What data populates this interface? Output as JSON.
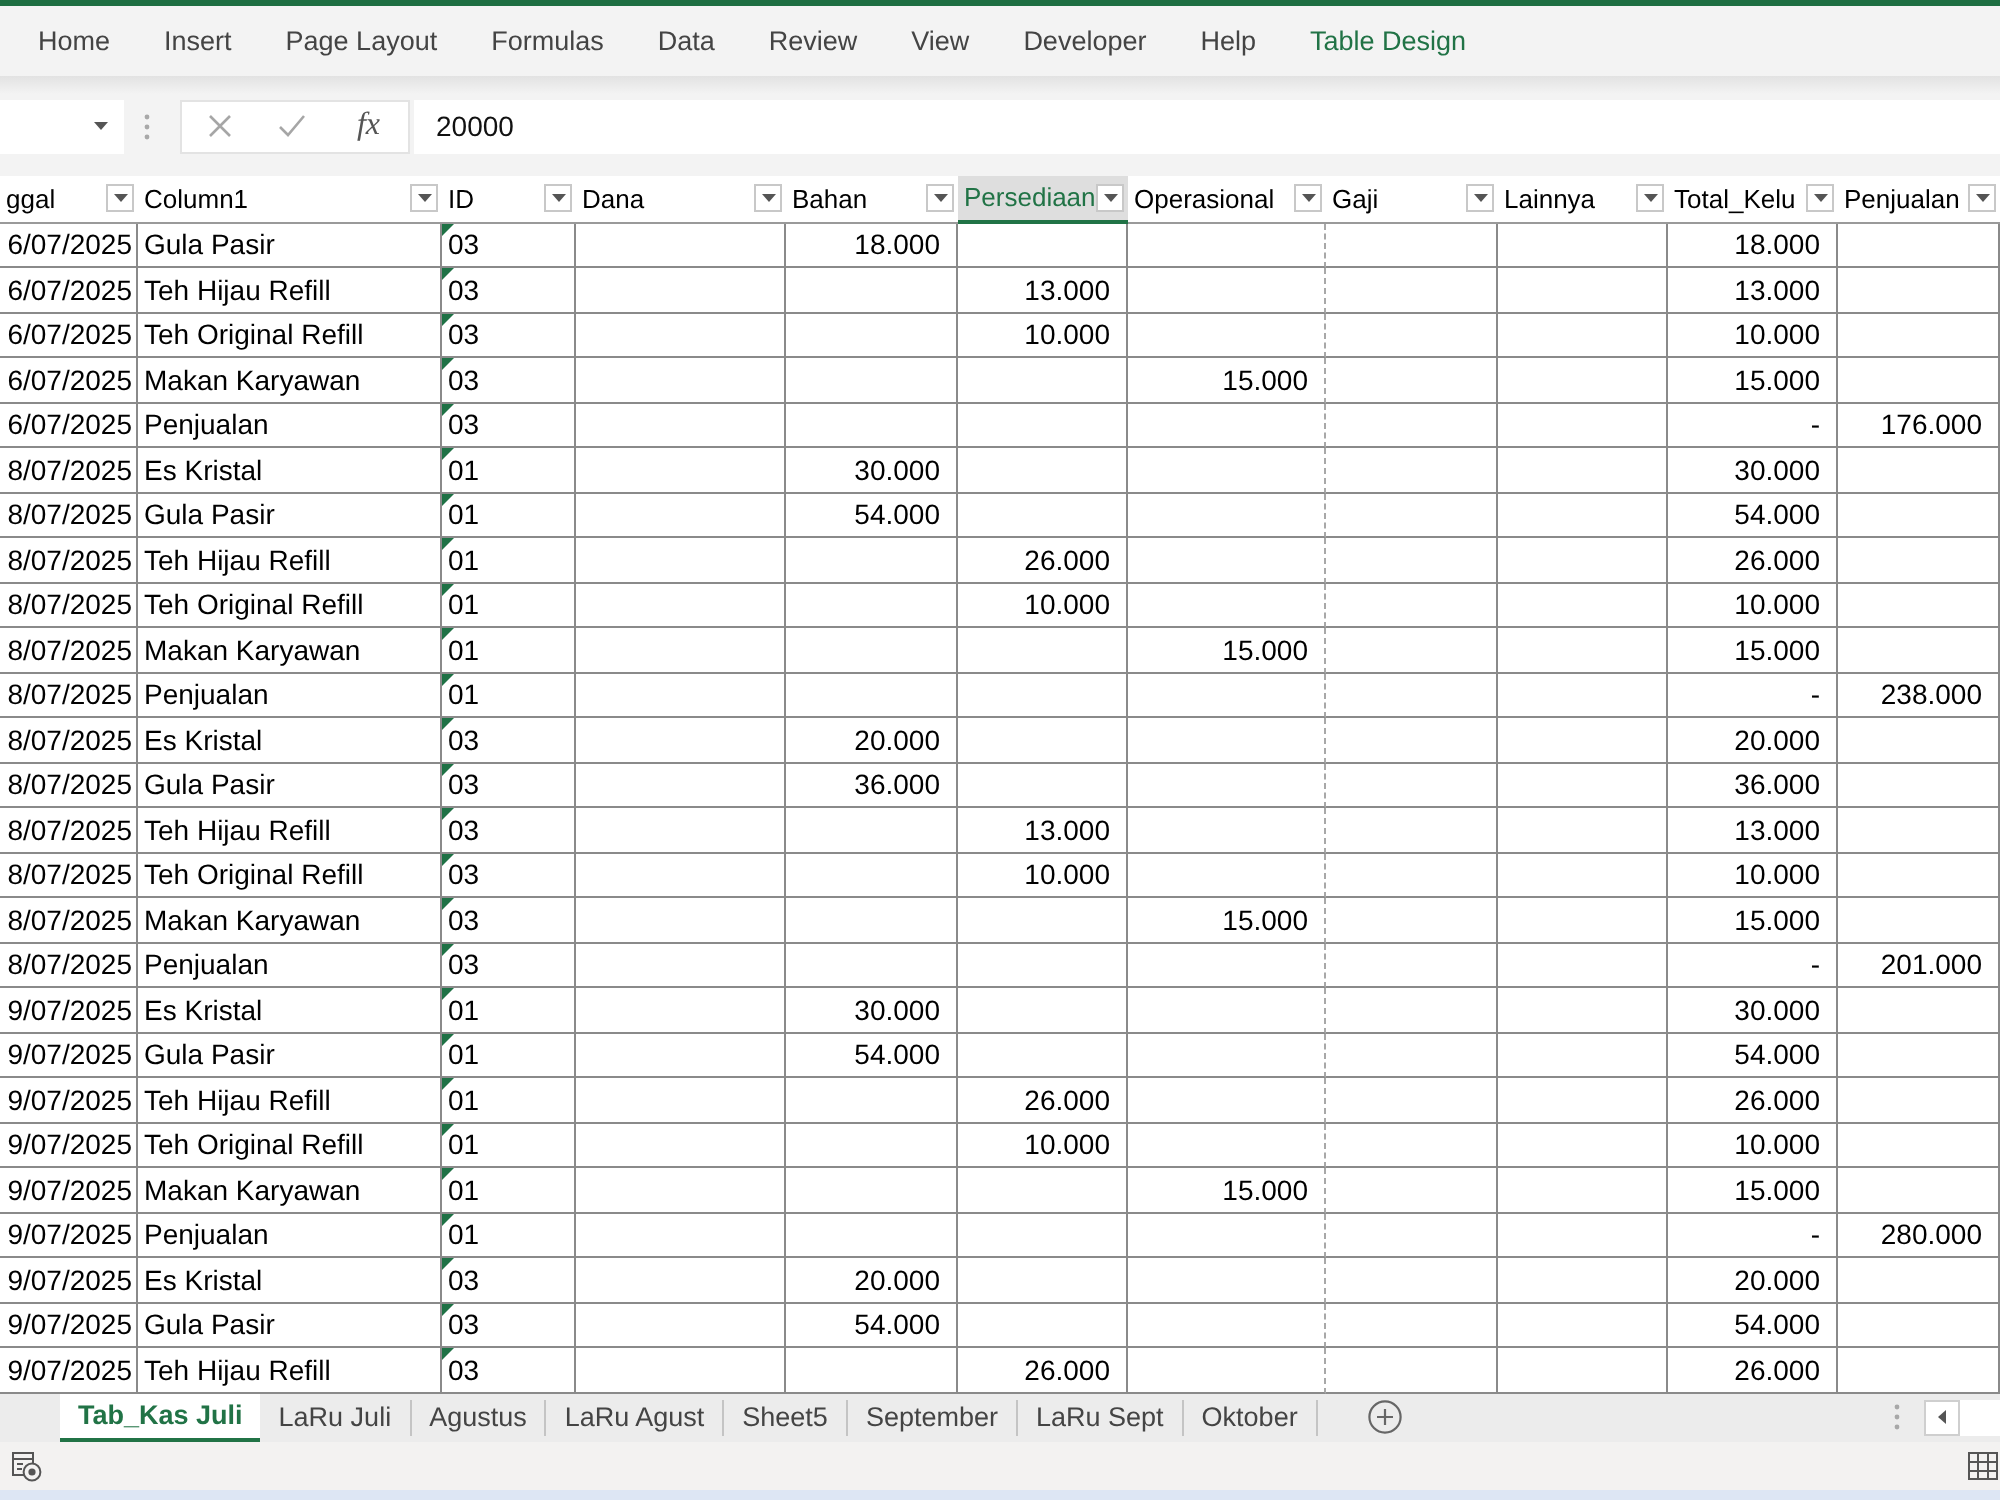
{
  "ribbon": {
    "tabs": [
      {
        "label": "Home",
        "kind": "standard",
        "selected": false
      },
      {
        "label": "Insert",
        "kind": "standard",
        "selected": false
      },
      {
        "label": "Page Layout",
        "kind": "standard",
        "selected": false
      },
      {
        "label": "Formulas",
        "kind": "standard",
        "selected": false
      },
      {
        "label": "Data",
        "kind": "standard",
        "selected": false
      },
      {
        "label": "Review",
        "kind": "standard",
        "selected": false
      },
      {
        "label": "View",
        "kind": "standard",
        "selected": false
      },
      {
        "label": "Developer",
        "kind": "standard",
        "selected": false
      },
      {
        "label": "Help",
        "kind": "standard",
        "selected": false
      },
      {
        "label": "Table Design",
        "kind": "contextual",
        "selected": false
      }
    ]
  },
  "formula_bar": {
    "function_label": "fx",
    "value": "20000"
  },
  "table": {
    "columns": [
      {
        "label": "ggal",
        "kind": "date",
        "selected": false
      },
      {
        "label": "Column1",
        "kind": "text",
        "selected": false
      },
      {
        "label": "ID",
        "kind": "code",
        "selected": false
      },
      {
        "label": "Dana",
        "kind": "number",
        "selected": false
      },
      {
        "label": "Bahan",
        "kind": "number",
        "selected": false
      },
      {
        "label": "Persediaan",
        "kind": "number",
        "selected": true
      },
      {
        "label": "Operasional",
        "kind": "number",
        "selected": false
      },
      {
        "label": "Gaji",
        "kind": "number",
        "selected": false
      },
      {
        "label": "Lainnya",
        "kind": "number",
        "selected": false
      },
      {
        "label": "Total_Kelu",
        "kind": "number",
        "selected": false
      },
      {
        "label": "Penjualan",
        "kind": "number",
        "selected": false
      }
    ],
    "rows": [
      {
        "date": "6/07/2025",
        "column1": "Gula Pasir",
        "id": "03",
        "bahan": "18.000",
        "total": "18.000"
      },
      {
        "date": "6/07/2025",
        "column1": "Teh Hijau Refill",
        "id": "03",
        "persediaan": "13.000",
        "total": "13.000"
      },
      {
        "date": "6/07/2025",
        "column1": "Teh Original Refill",
        "id": "03",
        "persediaan": "10.000",
        "total": "10.000"
      },
      {
        "date": "6/07/2025",
        "column1": "Makan Karyawan",
        "id": "03",
        "operasional": "15.000",
        "total": "15.000"
      },
      {
        "date": "6/07/2025",
        "column1": "Penjualan",
        "id": "03",
        "total": "-",
        "penjualan": "176.000"
      },
      {
        "date": "8/07/2025",
        "column1": "Es Kristal",
        "id": "01",
        "bahan": "30.000",
        "total": "30.000"
      },
      {
        "date": "8/07/2025",
        "column1": "Gula Pasir",
        "id": "01",
        "bahan": "54.000",
        "total": "54.000"
      },
      {
        "date": "8/07/2025",
        "column1": "Teh Hijau Refill",
        "id": "01",
        "persediaan": "26.000",
        "total": "26.000"
      },
      {
        "date": "8/07/2025",
        "column1": "Teh Original Refill",
        "id": "01",
        "persediaan": "10.000",
        "total": "10.000"
      },
      {
        "date": "8/07/2025",
        "column1": "Makan Karyawan",
        "id": "01",
        "operasional": "15.000",
        "total": "15.000"
      },
      {
        "date": "8/07/2025",
        "column1": "Penjualan",
        "id": "01",
        "total": "-",
        "penjualan": "238.000"
      },
      {
        "date": "8/07/2025",
        "column1": "Es Kristal",
        "id": "03",
        "bahan": "20.000",
        "total": "20.000"
      },
      {
        "date": "8/07/2025",
        "column1": "Gula Pasir",
        "id": "03",
        "bahan": "36.000",
        "total": "36.000"
      },
      {
        "date": "8/07/2025",
        "column1": "Teh Hijau Refill",
        "id": "03",
        "persediaan": "13.000",
        "total": "13.000"
      },
      {
        "date": "8/07/2025",
        "column1": "Teh Original Refill",
        "id": "03",
        "persediaan": "10.000",
        "total": "10.000"
      },
      {
        "date": "8/07/2025",
        "column1": "Makan Karyawan",
        "id": "03",
        "operasional": "15.000",
        "total": "15.000"
      },
      {
        "date": "8/07/2025",
        "column1": "Penjualan",
        "id": "03",
        "total": "-",
        "penjualan": "201.000"
      },
      {
        "date": "9/07/2025",
        "column1": "Es Kristal",
        "id": "01",
        "bahan": "30.000",
        "total": "30.000"
      },
      {
        "date": "9/07/2025",
        "column1": "Gula Pasir",
        "id": "01",
        "bahan": "54.000",
        "total": "54.000"
      },
      {
        "date": "9/07/2025",
        "column1": "Teh Hijau Refill",
        "id": "01",
        "persediaan": "26.000",
        "total": "26.000"
      },
      {
        "date": "9/07/2025",
        "column1": "Teh Original Refill",
        "id": "01",
        "persediaan": "10.000",
        "total": "10.000"
      },
      {
        "date": "9/07/2025",
        "column1": "Makan Karyawan",
        "id": "01",
        "operasional": "15.000",
        "total": "15.000"
      },
      {
        "date": "9/07/2025",
        "column1": "Penjualan",
        "id": "01",
        "total": "-",
        "penjualan": "280.000"
      },
      {
        "date": "9/07/2025",
        "column1": "Es Kristal",
        "id": "03",
        "bahan": "20.000",
        "total": "20.000"
      },
      {
        "date": "9/07/2025",
        "column1": "Gula Pasir",
        "id": "03",
        "bahan": "54.000",
        "total": "54.000"
      },
      {
        "date": "9/07/2025",
        "column1": "Teh Hijau Refill",
        "id": "03",
        "persediaan": "26.000",
        "total": "26.000"
      }
    ]
  },
  "sheet_tabs": [
    {
      "label": "Tab_Kas Juli",
      "selected": true
    },
    {
      "label": "LaRu Juli",
      "selected": false
    },
    {
      "label": "Agustus",
      "selected": false
    },
    {
      "label": "LaRu Agust",
      "selected": false
    },
    {
      "label": "Sheet5",
      "selected": false
    },
    {
      "label": "September",
      "selected": false
    },
    {
      "label": "LaRu Sept",
      "selected": false
    },
    {
      "label": "Oktober",
      "selected": false
    }
  ]
}
